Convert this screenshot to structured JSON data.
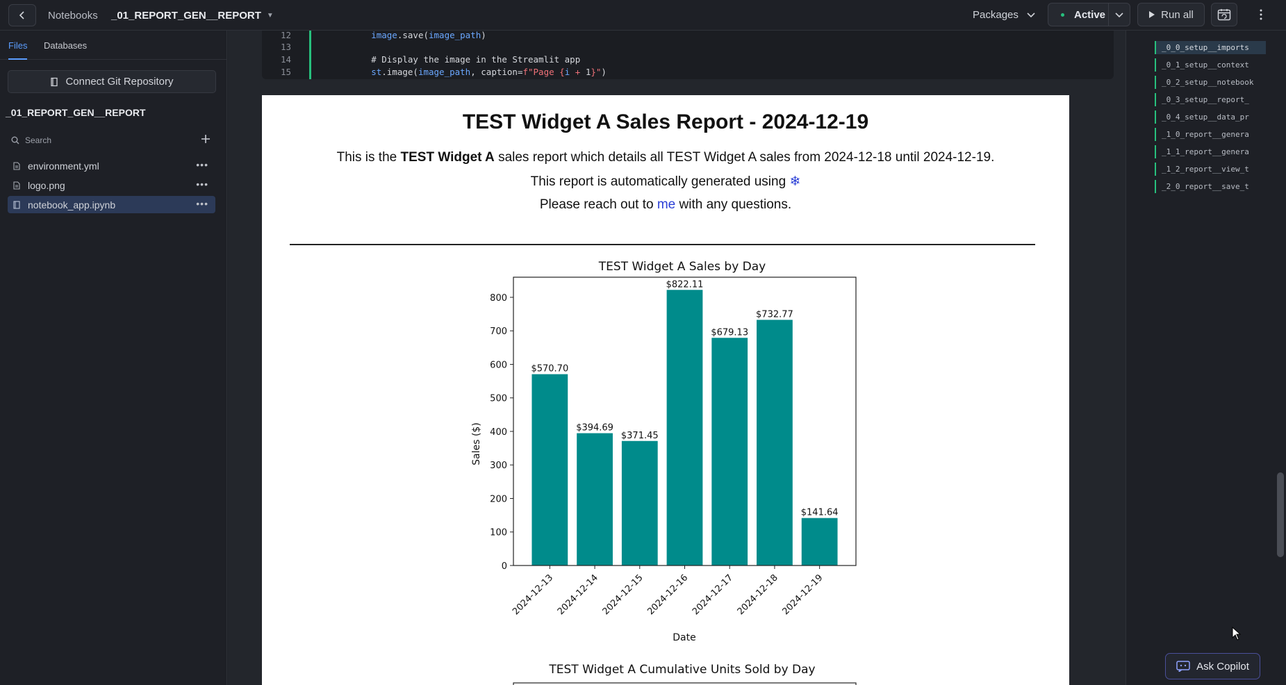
{
  "topbar": {
    "breadcrumb_notebooks": "Notebooks",
    "notebook_title": "_01_REPORT_GEN__REPORT",
    "packages_label": "Packages",
    "status_label": "Active",
    "run_all_label": "Run all"
  },
  "sidebar": {
    "tab_files": "Files",
    "tab_databases": "Databases",
    "git_button": "Connect Git Repository",
    "project_name": "_01_REPORT_GEN__REPORT",
    "search_placeholder": "Search",
    "files": [
      {
        "name": "environment.yml",
        "icon": "file-icon"
      },
      {
        "name": "logo.png",
        "icon": "file-icon"
      },
      {
        "name": "notebook_app.ipynb",
        "icon": "notebook-icon",
        "selected": true
      }
    ]
  },
  "code": {
    "lines": [
      {
        "num": "12",
        "text": "        image.save(image_path)"
      },
      {
        "num": "13",
        "text": ""
      },
      {
        "num": "14",
        "text": "        # Display the image in the Streamlit app"
      },
      {
        "num": "15",
        "text": "        st.image(image_path, caption=f\"Page {i + 1}\")"
      }
    ]
  },
  "report": {
    "title": "TEST Widget A Sales Report - 2024-12-19",
    "line1_pre": "This is the ",
    "line1_bold": "TEST Widget A",
    "line1_post": " sales report which details all TEST Widget A sales from 2024-12-18 until 2024-12-19.",
    "line2_pre": "This report is automatically generated using ",
    "line2_icon": "❄",
    "line3_pre": "Please reach out to ",
    "line3_link": "me",
    "line3_post": " with any questions.",
    "chart2_title": "TEST Widget A Cumulative Units Sold by Day"
  },
  "chart_data": {
    "type": "bar",
    "title": "TEST Widget A Sales by Day",
    "xlabel": "Date",
    "ylabel": "Sales ($)",
    "categories": [
      "2024-12-13",
      "2024-12-14",
      "2024-12-15",
      "2024-12-16",
      "2024-12-17",
      "2024-12-18",
      "2024-12-19"
    ],
    "values": [
      570.7,
      394.69,
      371.45,
      822.11,
      679.13,
      732.77,
      141.64
    ],
    "data_labels": [
      "$570.70",
      "$394.69",
      "$371.45",
      "$822.11",
      "$679.13",
      "$732.77",
      "$141.64"
    ],
    "ylim": [
      0,
      860
    ],
    "yticks": [
      0,
      100,
      200,
      300,
      400,
      500,
      600,
      700,
      800
    ],
    "bar_color": "#008b8b"
  },
  "outline": {
    "items": [
      "_0_0_setup__imports",
      "_0_1_setup__context",
      "_0_2_setup__notebook",
      "_0_3_setup__report_",
      "_0_4_setup__data_pr",
      "_1_0_report__genera",
      "_1_1_report__genera",
      "_1_2_report__view_t",
      "_2_0_report__save_t"
    ],
    "copilot_label": "Ask Copilot"
  }
}
